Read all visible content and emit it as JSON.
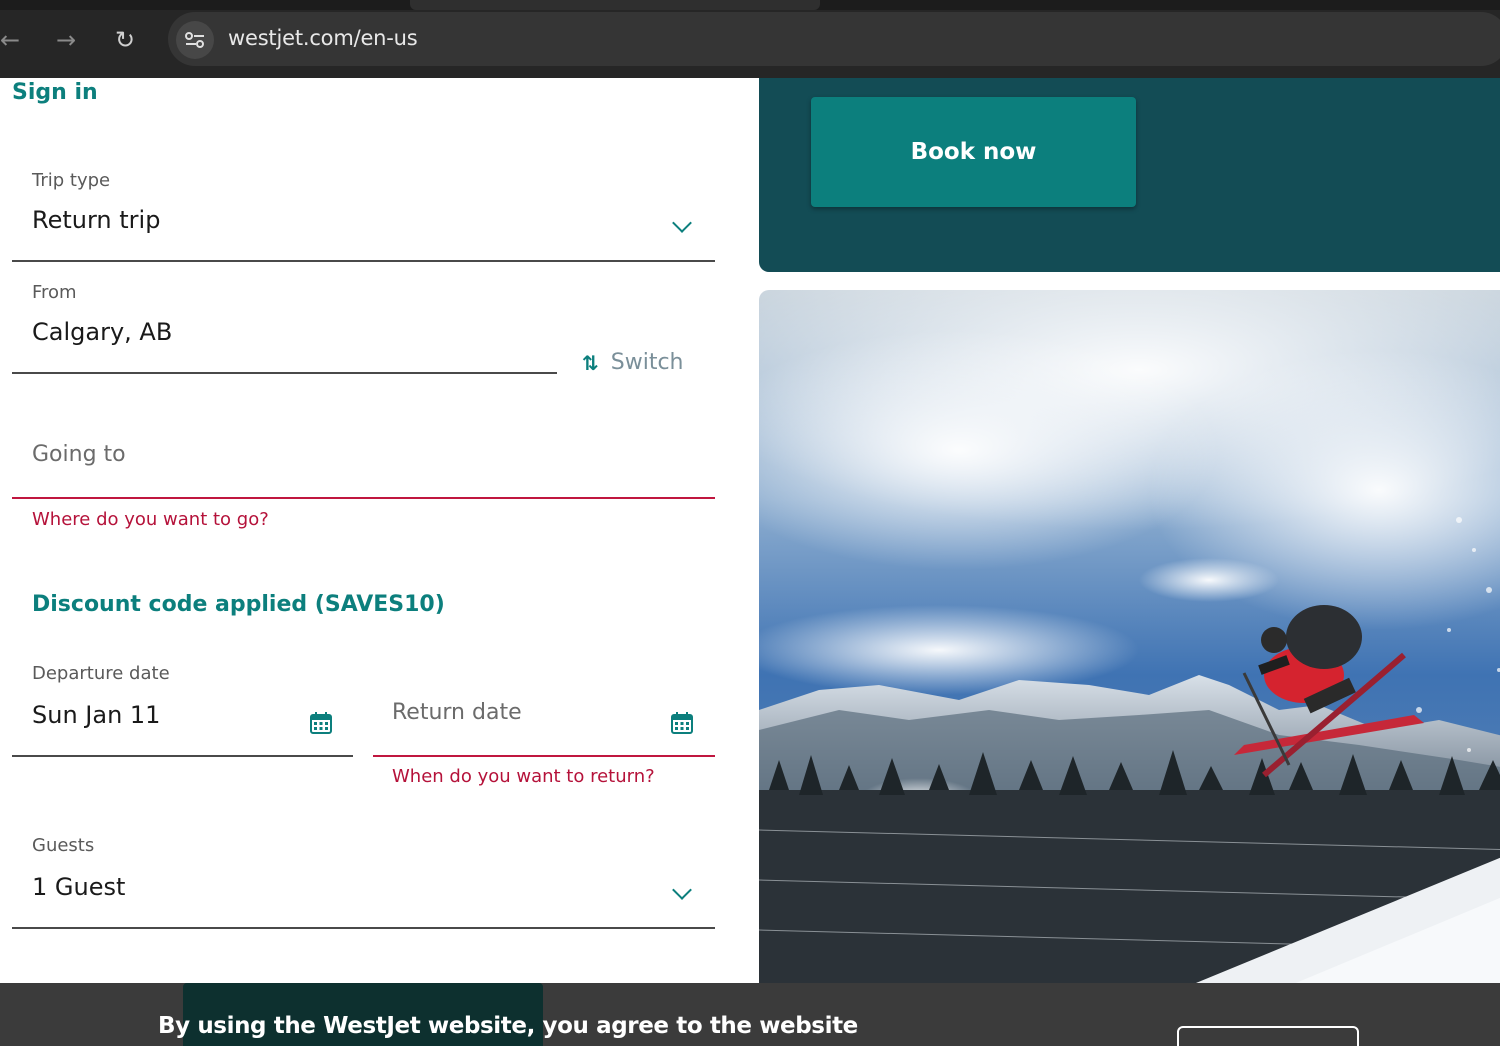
{
  "browser": {
    "url": "westjet.com/en-us",
    "back_icon": "arrow-left-icon",
    "forward_icon": "arrow-right-icon",
    "reload_icon": "reload-icon",
    "site_info_icon": "tune-icon"
  },
  "header": {
    "sign_in": "Sign in"
  },
  "form": {
    "trip_type": {
      "label": "Trip type",
      "value": "Return trip"
    },
    "from": {
      "label": "From",
      "value": "Calgary, AB"
    },
    "switch_label": "Switch",
    "going_to": {
      "placeholder": "Going to",
      "error": "Where do you want to go?"
    },
    "discount": "Discount code applied (SAVES10)",
    "departure": {
      "label": "Departure date",
      "value": "Sun Jan 11"
    },
    "return": {
      "placeholder": "Return date",
      "error": "When do you want to return?"
    },
    "guests": {
      "label": "Guests",
      "value": "1 Guest"
    }
  },
  "promo": {
    "book_now": "Book now"
  },
  "cookie_banner": {
    "text": "By using the WestJet website, you agree to the website"
  },
  "colors": {
    "brand_teal": "#0c7f7d",
    "dark_teal": "#134c55",
    "error_red": "#b5123a"
  }
}
